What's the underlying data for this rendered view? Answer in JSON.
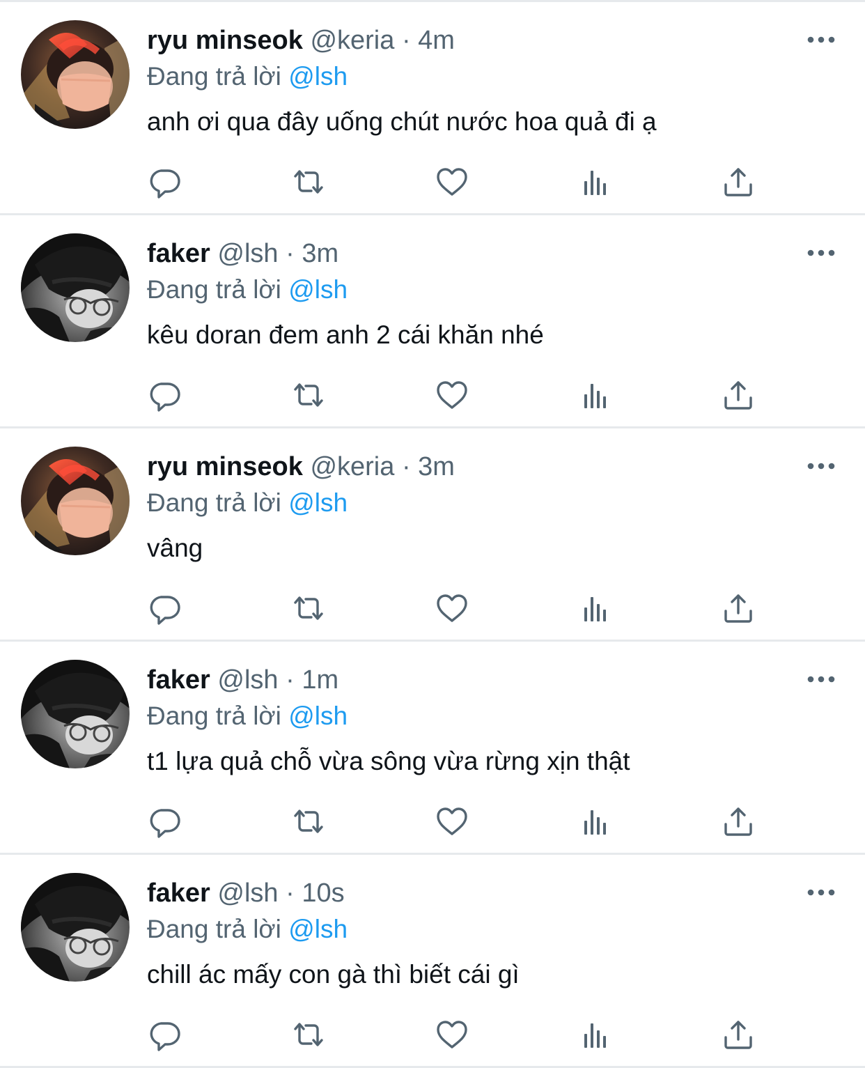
{
  "colors": {
    "text_primary": "#0f1419",
    "text_secondary": "#536471",
    "mention": "#1d9bf0",
    "divider": "#e6e9ec",
    "icon": "#536471"
  },
  "actions_icons": [
    "reply-icon",
    "retweet-icon",
    "like-icon",
    "views-icon",
    "share-icon"
  ],
  "tweets": [
    {
      "name": "ryu minseok",
      "handle": "@keria",
      "separator": "·",
      "time": "4m",
      "reply_prefix": "Đang trả lời",
      "reply_to": "@lsh",
      "text": "anh ơi qua đây uống chút nước hoa quả đi ạ",
      "avatar": "keria"
    },
    {
      "name": "faker",
      "handle": "@lsh",
      "separator": "·",
      "time": "3m",
      "reply_prefix": "Đang trả lời",
      "reply_to": "@lsh",
      "text": "kêu doran đem anh 2 cái khăn nhé",
      "avatar": "faker"
    },
    {
      "name": "ryu minseok",
      "handle": "@keria",
      "separator": "·",
      "time": "3m",
      "reply_prefix": "Đang trả lời",
      "reply_to": "@lsh",
      "text": "vâng",
      "avatar": "keria"
    },
    {
      "name": "faker",
      "handle": "@lsh",
      "separator": "·",
      "time": "1m",
      "reply_prefix": "Đang trả lời",
      "reply_to": "@lsh",
      "text": "t1 lựa quả chỗ vừa sông vừa rừng xịn thật",
      "avatar": "faker"
    },
    {
      "name": "faker",
      "handle": "@lsh",
      "separator": "·",
      "time": "10s",
      "reply_prefix": "Đang trả lời",
      "reply_to": "@lsh",
      "text": "chill ác mấy con gà thì biết cái gì",
      "avatar": "faker"
    }
  ]
}
